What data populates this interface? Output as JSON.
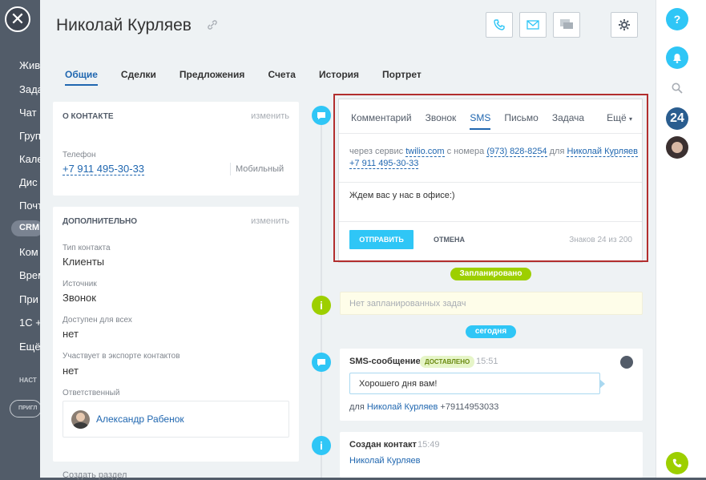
{
  "background_nav": {
    "items": [
      "Жив",
      "Зада",
      "Чат",
      "Груп",
      "Кале",
      "Дис",
      "Почт",
      "Ком",
      "Врем",
      "При",
      "1С +",
      "Ещё"
    ],
    "crm_label": "CRM",
    "settings_label": "НАСТ",
    "invite_label": "ПРИГЛ"
  },
  "header": {
    "contact_name": "Николай Курляев"
  },
  "tabs": [
    "Общие",
    "Сделки",
    "Предложения",
    "Счета",
    "История",
    "Портрет"
  ],
  "about_card": {
    "title": "О КОНТАКТЕ",
    "edit_label": "изменить",
    "phone_label": "Телефон",
    "phone_value": "+7 911 495-30-33",
    "phone_type": "Мобильный"
  },
  "extra_card": {
    "title": "ДОПОЛНИТЕЛЬНО",
    "edit_label": "изменить",
    "fields": [
      {
        "label": "Тип контакта",
        "value": "Клиенты"
      },
      {
        "label": "Источник",
        "value": "Звонок"
      },
      {
        "label": "Доступен для всех",
        "value": "нет"
      },
      {
        "label": "Участвует в экспорте контактов",
        "value": "нет"
      }
    ],
    "responsible_label": "Ответственный",
    "responsible_name": "Александр Рабенок",
    "create_section": "Создать раздел"
  },
  "editor": {
    "tabs": [
      "Комментарий",
      "Звонок",
      "SMS",
      "Письмо",
      "Задача"
    ],
    "more_label": "Ещё",
    "via_text": "через сервис",
    "service": "twilio.com",
    "from_text": "с номера",
    "from_number": "(973) 828-8254",
    "for_text": "для",
    "recipient": "Николай Курляев",
    "recipient_phone": "+7 911 495-30-33",
    "message": "Ждем вас у нас в офисе:)",
    "send_label": "ОТПРАВИТЬ",
    "cancel_label": "ОТМЕНА",
    "counter": "Знаков 24 из 200"
  },
  "timeline": {
    "planned_badge": "Запланировано",
    "no_tasks": "Нет запланированных задач",
    "today_badge": "сегодня",
    "sms_title": "SMS-сообщение",
    "sms_status": "ДОСТАВЛЕНО",
    "sms_time": "15:51",
    "sms_text": "Хорошего дня вам!",
    "sms_for_prefix": "для",
    "sms_for_name": "Николай Курляев",
    "sms_for_phone": "+79114953033",
    "created_title": "Создан контакт",
    "created_time": "15:49",
    "created_name": "Николай Курляев"
  },
  "right_bar": {
    "counter": "24"
  },
  "colors": {
    "accent_blue": "#2fc6f6",
    "link": "#2067b0",
    "green": "#9dcf00",
    "frame_red": "#b22e2e"
  }
}
